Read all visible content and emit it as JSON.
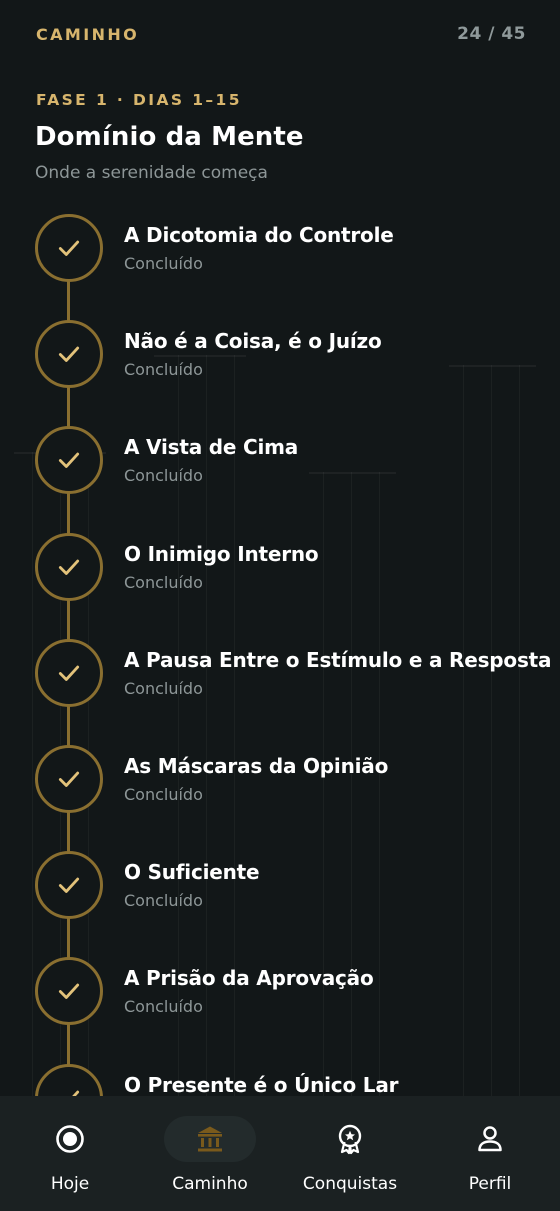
{
  "header": {
    "title": "CAMINHO",
    "progress": "24 / 45"
  },
  "phase": {
    "label": "FASE 1 · DIAS 1–15",
    "title": "Domínio da Mente",
    "subtitle": "Onde a serenidade começa"
  },
  "steps": [
    {
      "title": "A Dicotomia do Controle",
      "status": "Concluído",
      "icon": "check-icon"
    },
    {
      "title": "Não é a Coisa, é o Juízo",
      "status": "Concluído",
      "icon": "check-icon"
    },
    {
      "title": "A Vista de Cima",
      "status": "Concluído",
      "icon": "check-icon"
    },
    {
      "title": "O Inimigo Interno",
      "status": "Concluído",
      "icon": "check-icon"
    },
    {
      "title": "A Pausa Entre o Estímulo e a Resposta",
      "status": "Concluído",
      "icon": "check-icon"
    },
    {
      "title": "As Máscaras da Opinião",
      "status": "Concluído",
      "icon": "check-icon"
    },
    {
      "title": "O Suficiente",
      "status": "Concluído",
      "icon": "check-icon"
    },
    {
      "title": "A Prisão da Aprovação",
      "status": "Concluído",
      "icon": "check-icon"
    },
    {
      "title": "O Presente é o Único Lar",
      "status": "",
      "icon": "check-icon"
    }
  ],
  "nav": [
    {
      "label": "Hoje",
      "icon": "target-icon",
      "active": false
    },
    {
      "label": "Caminho",
      "icon": "temple-icon",
      "active": true
    },
    {
      "label": "Conquistas",
      "icon": "badge-icon",
      "active": false
    },
    {
      "label": "Perfil",
      "icon": "user-icon",
      "active": false
    }
  ],
  "colors": {
    "background": "#121718",
    "accent": "#d7b56d",
    "ring": "#8a6f30",
    "muted": "#8d9697",
    "nav_background": "#1b2122"
  }
}
